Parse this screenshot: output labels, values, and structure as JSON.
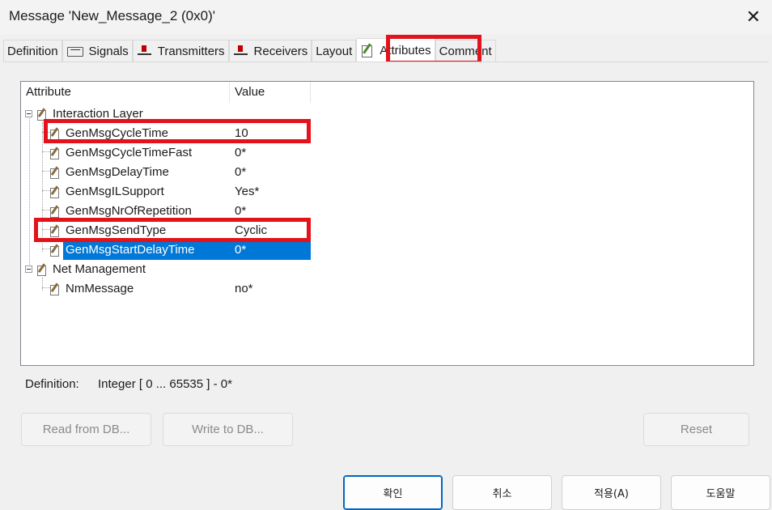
{
  "window": {
    "title": "Message 'New_Message_2 (0x0)'",
    "close_glyph": "✕"
  },
  "tabs": [
    {
      "label": "Definition",
      "icon": null,
      "active": false
    },
    {
      "label": "Signals",
      "icon": "signal-icon",
      "active": false
    },
    {
      "label": "Transmitters",
      "icon": "transmitter-icon",
      "active": false
    },
    {
      "label": "Receivers",
      "icon": "receiver-icon",
      "active": false
    },
    {
      "label": "Layout",
      "icon": null,
      "active": false
    },
    {
      "label": "Attributes",
      "icon": "attribute-icon",
      "active": true
    },
    {
      "label": "Comment",
      "icon": null,
      "active": false
    }
  ],
  "tree": {
    "columns": {
      "attribute": "Attribute",
      "value": "Value"
    },
    "groups": [
      {
        "label": "Interaction Layer",
        "items": [
          {
            "label": "GenMsgCycleTime",
            "value": "10"
          },
          {
            "label": "GenMsgCycleTimeFast",
            "value": "0*"
          },
          {
            "label": "GenMsgDelayTime",
            "value": "0*"
          },
          {
            "label": "GenMsgILSupport",
            "value": "Yes*"
          },
          {
            "label": "GenMsgNrOfRepetition",
            "value": "0*"
          },
          {
            "label": "GenMsgSendType",
            "value": "Cyclic"
          },
          {
            "label": "GenMsgStartDelayTime",
            "value": "0*",
            "selected": true
          }
        ]
      },
      {
        "label": "Net Management",
        "items": [
          {
            "label": "NmMessage",
            "value": "no*"
          }
        ]
      }
    ]
  },
  "definition": {
    "label": "Definition:",
    "value": "Integer [ 0 ... 65535 ] - 0*"
  },
  "buttons": {
    "read_from_db": "Read from DB...",
    "write_to_db": "Write to DB...",
    "reset": "Reset"
  },
  "footer": {
    "ok": "확인",
    "cancel": "취소",
    "apply": "적용(A)",
    "help": "도움말"
  },
  "colors": {
    "highlight_red": "#e3121b",
    "selection_blue": "#0078d7"
  }
}
